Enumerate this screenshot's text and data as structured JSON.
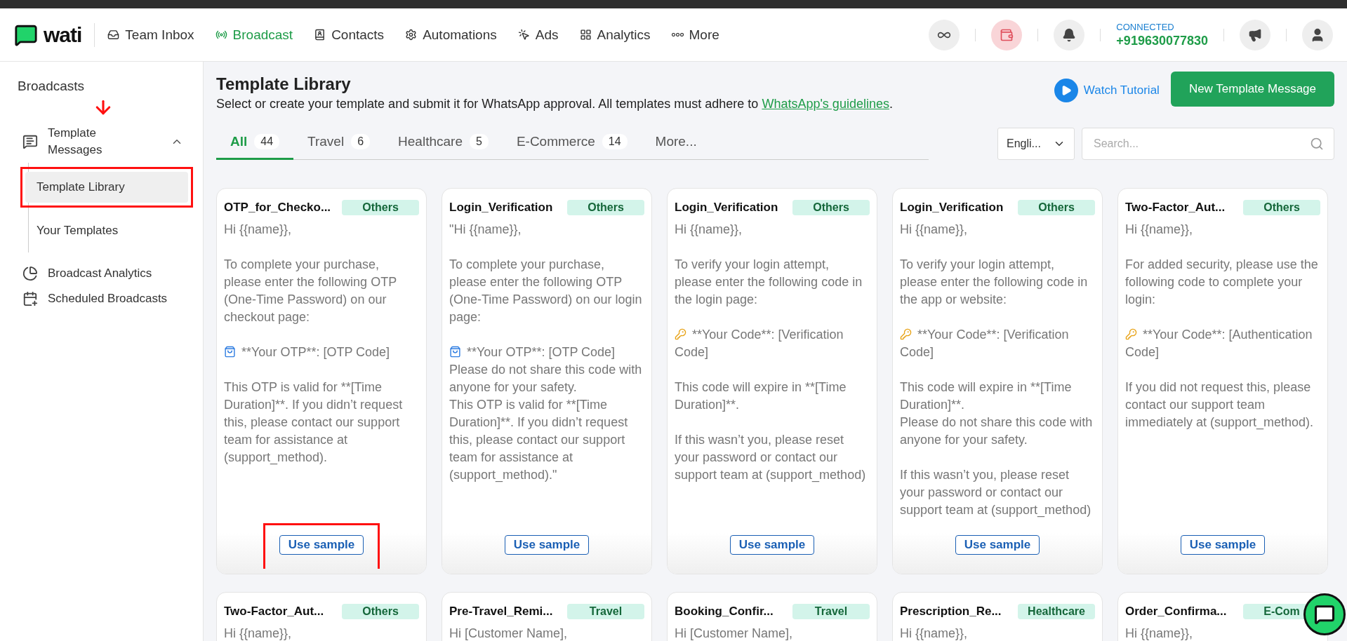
{
  "brand": "wati",
  "nav": [
    {
      "kind": "inbox",
      "label": "Team Inbox",
      "selected": false
    },
    {
      "kind": "broadcast",
      "label": "Broadcast",
      "selected": true
    },
    {
      "kind": "contacts",
      "label": "Contacts",
      "selected": false
    },
    {
      "kind": "automations",
      "label": "Automations",
      "selected": false
    },
    {
      "kind": "ads",
      "label": "Ads",
      "selected": false
    },
    {
      "kind": "analytics",
      "label": "Analytics",
      "selected": false
    },
    {
      "kind": "more",
      "label": "More",
      "selected": false
    }
  ],
  "connection": {
    "status": "CONNECTED",
    "phone": "+919630077830"
  },
  "sidebar": {
    "title": "Broadcasts",
    "items": [
      {
        "kind": "templates",
        "label": "Template Messages",
        "expanded": true,
        "arrow_annotation": true,
        "children": [
          {
            "label": "Template Library",
            "selected": true,
            "annotated": true
          },
          {
            "label": "Your Templates",
            "selected": false,
            "annotated": false
          }
        ]
      },
      {
        "kind": "analytics",
        "label": "Broadcast Analytics"
      },
      {
        "kind": "scheduled",
        "label": "Scheduled Broadcasts"
      }
    ]
  },
  "header": {
    "title": "Template Library",
    "subtitle": "Select or create your template and submit it for WhatsApp approval. All templates must adhere to ",
    "link": "WhatsApp's guidelines",
    "subtitle_end": ".",
    "watch_tutorial": "Watch Tutorial",
    "new_button": "New Template Message"
  },
  "tabs": [
    {
      "label": "All",
      "count": "44",
      "selected": true
    },
    {
      "label": "Travel",
      "count": "6",
      "selected": false
    },
    {
      "label": "Healthcare",
      "count": "5",
      "selected": false
    },
    {
      "label": "E-Commerce",
      "count": "14",
      "selected": false
    },
    {
      "label": "More...",
      "selected": false
    }
  ],
  "language": {
    "value": "Engli..."
  },
  "search": {
    "placeholder": "Search..."
  },
  "cards": [
    {
      "title": "OTP_for_Checko...",
      "tag": "Others",
      "button": "Use sample",
      "button_annotated": true,
      "body": [
        {
          "kind": "text",
          "text": "Hi {{name}},"
        },
        {
          "kind": "text",
          "text": "To complete your purchase, please enter the following OTP (One-Time Password) on our checkout page:"
        },
        {
          "kind": "bag",
          "text": "**Your OTP**: [OTP Code]"
        },
        {
          "kind": "text",
          "text": "This OTP is valid for **[Time Duration]**. If you didn’t request this, please contact our support team for assistance at (support_method)."
        }
      ]
    },
    {
      "title": "Login_Verification",
      "tag": "Others",
      "button": "Use sample",
      "button_annotated": false,
      "body": [
        {
          "kind": "text",
          "text": "\"Hi {{name}},"
        },
        {
          "kind": "text",
          "text": "To complete your purchase, please enter the following OTP (One-Time Password) on our login page:"
        },
        {
          "kind": "bag",
          "text": "**Your OTP**: [OTP Code]\nPlease do not share this code with anyone for your safety.\nThis OTP is valid for **[Time Duration]**. If you didn’t request this, please contact our support team for assistance at (support_method).\""
        }
      ]
    },
    {
      "title": "Login_Verification",
      "tag": "Others",
      "button": "Use sample",
      "button_annotated": false,
      "body": [
        {
          "kind": "text",
          "text": "Hi {{name}},"
        },
        {
          "kind": "text",
          "text": "To verify your login attempt, please enter the following code in the login page:"
        },
        {
          "kind": "key",
          "text": "**Your Code**: [Verification Code]"
        },
        {
          "kind": "text",
          "text": "This code will expire in **[Time Duration]**."
        },
        {
          "kind": "text",
          "text": "If this wasn’t you, please reset your password or contact our support team at (support_method)"
        }
      ]
    },
    {
      "title": "Login_Verification",
      "tag": "Others",
      "button": "Use sample",
      "button_annotated": false,
      "body": [
        {
          "kind": "text",
          "text": "Hi {{name}},"
        },
        {
          "kind": "text",
          "text": "To verify your login attempt, please enter the following code in the app or website:"
        },
        {
          "kind": "key",
          "text": "**Your Code**: [Verification Code]"
        },
        {
          "kind": "text",
          "text": "This code will expire in **[Time Duration]**.\nPlease do not share this code with anyone for your safety."
        },
        {
          "kind": "text",
          "text": "If this wasn’t you, please reset your password or contact our support team at (support_method)"
        }
      ]
    },
    {
      "title": "Two-Factor_Aut...",
      "tag": "Others",
      "button": "Use sample",
      "button_annotated": false,
      "body": [
        {
          "kind": "text",
          "text": "Hi {{name}},"
        },
        {
          "kind": "text",
          "text": "For added security, please use the following code to complete your login:"
        },
        {
          "kind": "key",
          "text": "**Your Code**: [Authentication Code]"
        },
        {
          "kind": "text",
          "text": "If you did not request this, please contact our support team immediately at (support_method)."
        }
      ]
    },
    {
      "title": "Two-Factor_Aut...",
      "tag": "Others",
      "body": [
        {
          "kind": "text",
          "text": "Hi {{name}},"
        }
      ]
    },
    {
      "title": "Pre-Travel_Remi...",
      "tag": "Travel",
      "body": [
        {
          "kind": "text",
          "text": "Hi [Customer Name],"
        }
      ]
    },
    {
      "title": "Booking_Confir...",
      "tag": "Travel",
      "body": [
        {
          "kind": "text",
          "text": "Hi [Customer Name],"
        }
      ]
    },
    {
      "title": "Prescription_Re...",
      "tag": "Healthcare",
      "body": [
        {
          "kind": "text",
          "text": "Hi {{name}},"
        }
      ]
    },
    {
      "title": "Order_Confirma...",
      "tag": "E-Com",
      "body": [
        {
          "kind": "text",
          "text": "Hi {{name}},"
        }
      ]
    }
  ]
}
